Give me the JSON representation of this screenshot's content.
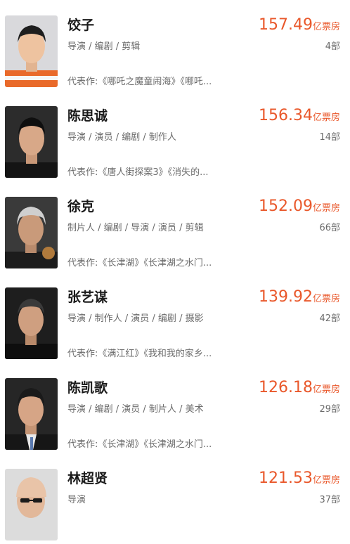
{
  "directors": [
    {
      "name": "饺子",
      "roles": "导演 / 编剧 / 剪辑",
      "box_office": "157.49",
      "box_office_unit": "亿票房",
      "film_count": "4部",
      "works": "代表作:《哪吒之魔童闹海》《哪吒..."
    },
    {
      "name": "陈思诚",
      "roles": "导演 / 演员 / 编剧 / 制作人",
      "box_office": "156.34",
      "box_office_unit": "亿票房",
      "film_count": "14部",
      "works": "代表作:《唐人街探案3》《消失的..."
    },
    {
      "name": "徐克",
      "roles": "制片人 / 编剧 / 导演 / 演员 / 剪辑",
      "box_office": "152.09",
      "box_office_unit": "亿票房",
      "film_count": "66部",
      "works": "代表作:《长津湖》《长津湖之水门..."
    },
    {
      "name": "张艺谋",
      "roles": "导演 / 制作人 / 演员 / 编剧 / 摄影",
      "box_office": "139.92",
      "box_office_unit": "亿票房",
      "film_count": "42部",
      "works": "代表作:《满江红》《我和我的家乡..."
    },
    {
      "name": "陈凯歌",
      "roles": "导演 / 编剧 / 演员 / 制片人 / 美术",
      "box_office": "126.18",
      "box_office_unit": "亿票房",
      "film_count": "29部",
      "works": "代表作:《长津湖》《长津湖之水门..."
    },
    {
      "name": "林超贤",
      "roles": "导演",
      "box_office": "121.53",
      "box_office_unit": "亿票房",
      "film_count": "37部",
      "works": ""
    }
  ]
}
